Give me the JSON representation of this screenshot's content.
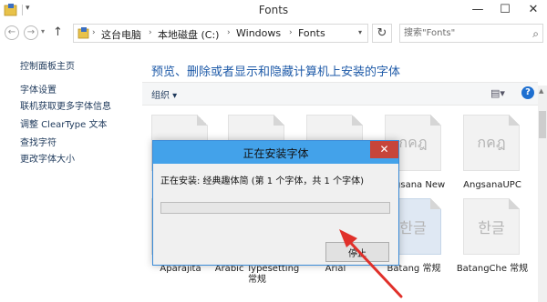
{
  "window": {
    "title": "Fonts",
    "min_glyph": "—",
    "max_glyph": "☐",
    "close_glyph": "✕"
  },
  "nav": {
    "back_glyph": "←",
    "forward_glyph": "→",
    "up_glyph": "↑",
    "breadcrumbs": [
      "这台电脑",
      "本地磁盘 (C:)",
      "Windows",
      "Fonts"
    ],
    "refresh_glyph": "↻",
    "search_placeholder": "搜索\"Fonts\"",
    "search_glyph": "⌕"
  },
  "sidebar": {
    "items": [
      {
        "label": "控制面板主页"
      },
      {
        "label": "字体设置"
      },
      {
        "label": "联机获取更多字体信息"
      },
      {
        "label": "调整 ClearType 文本"
      },
      {
        "label": "查找字符"
      },
      {
        "label": "更改字体大小"
      }
    ]
  },
  "main": {
    "heading": "预览、删除或者显示和隐藏计算机上安装的字体",
    "organize_label": "组织 ▾",
    "view_glyph": "▤▾",
    "help_glyph": "?",
    "fonts": [
      {
        "label": "",
        "glyph": ""
      },
      {
        "label": "",
        "glyph": ""
      },
      {
        "label": "",
        "glyph": ""
      },
      {
        "label": "Angsana New",
        "glyph": "กคฎ"
      },
      {
        "label": "AngsanaUPC",
        "glyph": "กคฎ"
      },
      {
        "label": "Aparajita",
        "glyph": ""
      },
      {
        "label": "Arabic Typesetting 常规",
        "glyph": ""
      },
      {
        "label": "Arial",
        "glyph": ""
      },
      {
        "label": "Batang 常规",
        "glyph": "한글"
      },
      {
        "label": "BatangChe 常规",
        "glyph": "한글"
      }
    ]
  },
  "dialog": {
    "title": "正在安装字体",
    "close_glyph": "✕",
    "status": "正在安装: 经典趣体简 (第 1 个字体，共 1 个字体)",
    "progress": 0,
    "stop_label": "停止"
  },
  "colors": {
    "accent": "#1e5aa8",
    "dialog_title_bg": "#43a2ea",
    "dialog_close_bg": "#c7453a",
    "annotation_arrow": "#e0302a"
  }
}
